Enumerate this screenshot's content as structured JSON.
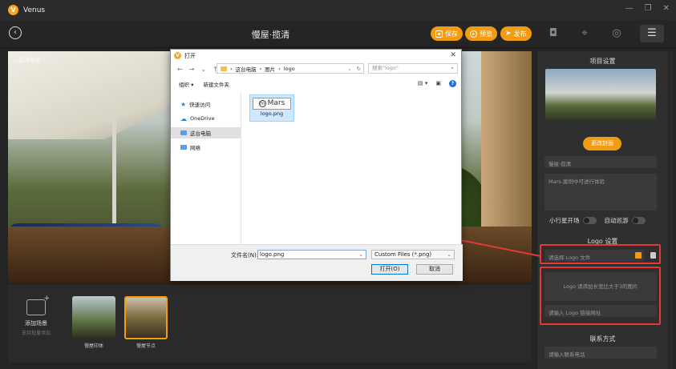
{
  "app": {
    "name": "Venus",
    "logo_letter": "V"
  },
  "window": {
    "minimize": "—",
    "restore": "❐",
    "close": "✕"
  },
  "toolbar": {
    "back": "‹",
    "title": "慢屋·揽清",
    "save_label": "保存",
    "preview_label": "预览",
    "publish_label": "发布",
    "tools": [
      "camera-icon",
      "crosshair-icon",
      "compass-icon",
      "settings-sliders-icon"
    ]
  },
  "scene": {
    "watermark": "元碧海新星"
  },
  "scenes_bar": {
    "add_label": "添加场景",
    "add_sub": "支持批量添加",
    "items": [
      {
        "label": "慢屋印体",
        "selected": false
      },
      {
        "label": "慢屋节点",
        "selected": true
      }
    ]
  },
  "panel": {
    "project_settings": "项目设置",
    "change_cover": "更改封面",
    "project_name": "慢屋·揽清",
    "project_desc": "Mars-案例中可进行体验",
    "toggle_planet": "小行星开场",
    "toggle_cruise": "自动巡游",
    "logo_settings": "Logo 设置",
    "logo_file_placeholder": "请选择 Logo 文件",
    "logo_hint": "Logo 请添加长宽比大于3的图片",
    "logo_link_placeholder": "请输入 Logo 链接网址",
    "contact": "联系方式",
    "contact_phone_placeholder": "请输入联系电话"
  },
  "dialog": {
    "title": "打开",
    "close": "✕",
    "breadcrumb": [
      "这台电脑",
      "图片",
      "logo"
    ],
    "search_placeholder": "搜索\"logo\"",
    "organize": "组织 ▾",
    "new_folder": "新建文件夹",
    "nav": [
      {
        "label": "快速访问",
        "icon": "star-icon",
        "color": "#2f7fd8"
      },
      {
        "label": "OneDrive",
        "icon": "cloud-icon",
        "color": "#2f7fd8"
      },
      {
        "label": "这台电脑",
        "icon": "computer-icon",
        "color": "#5aa0e0",
        "selected": true
      },
      {
        "label": "网络",
        "icon": "network-icon",
        "color": "#5aa0e0"
      }
    ],
    "file": {
      "preview_text": "Mars",
      "name": "logo.png"
    },
    "filename_label": "文件名(N):",
    "filename_value": "logo.png",
    "filter_value": "Custom Files (*.png)",
    "open_button": "打开(O)",
    "cancel_button": "取消"
  },
  "colors": {
    "accent": "#f39c12",
    "highlight": "#e53935"
  }
}
